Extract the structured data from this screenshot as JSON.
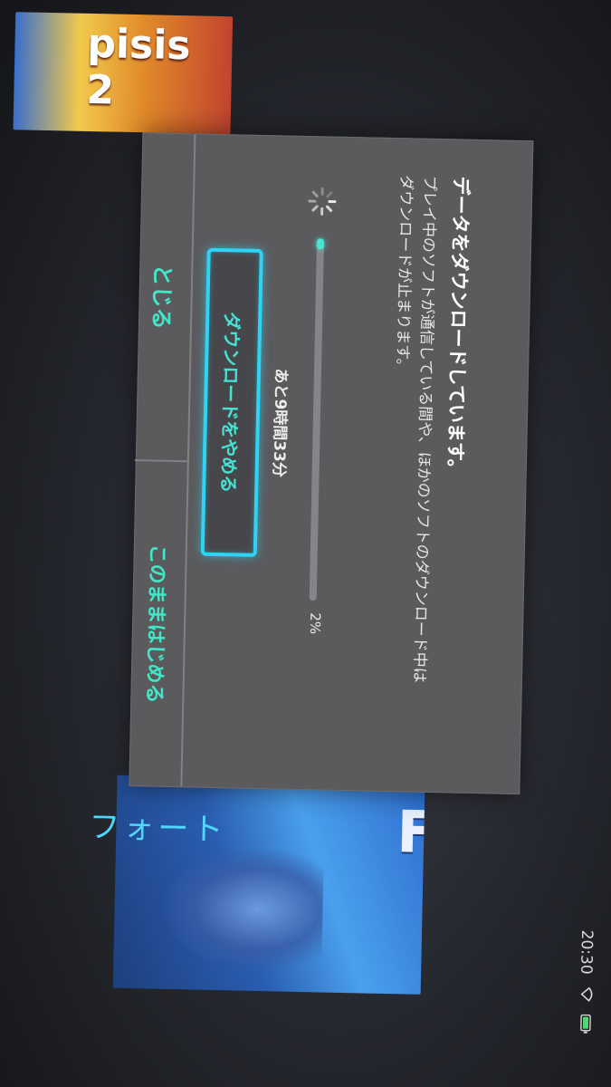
{
  "status": {
    "time": "20:30",
    "wifi_icon": "wifi-icon",
    "battery_icon": "battery-icon"
  },
  "background": {
    "section_label": "フォート",
    "fortnite_logo": "FORT",
    "game2_text": "pisis 2"
  },
  "dialog": {
    "title": "データをダウンロードしています。",
    "description_line1": "プレイ中のソフトが通信している間や、ほかのソフトのダウンロード中は",
    "description_line2": "ダウンロードが止まります。",
    "progress": {
      "percent_label": "2%",
      "value": 0.02,
      "remaining": "あと9時間33分"
    },
    "stop_download_button": "ダウンロードをやめる",
    "close_button": "とじる",
    "start_anyway_button": "このままはじめる"
  },
  "colors": {
    "accent": "#42e6c8",
    "focus_border": "#2fd4f4",
    "dialog_bg": "#5b5b5e"
  }
}
